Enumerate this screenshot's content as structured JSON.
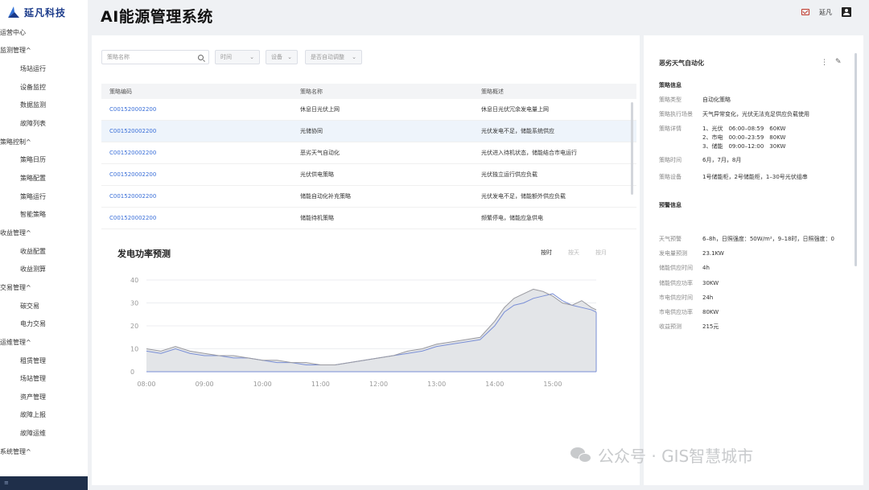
{
  "app": {
    "brand": "延凡科技",
    "title": "AI能源管理系统",
    "user": "延凡"
  },
  "sidebar": {
    "items": [
      {
        "label": "运营中心",
        "type": "group"
      },
      {
        "label": "监测管理",
        "type": "group",
        "chevron": "^"
      },
      {
        "label": "场站运行",
        "type": "sub"
      },
      {
        "label": "设备监控",
        "type": "sub"
      },
      {
        "label": "数据监测",
        "type": "sub"
      },
      {
        "label": "故障列表",
        "type": "sub"
      },
      {
        "label": "策略控制",
        "type": "group",
        "chevron": "^"
      },
      {
        "label": "策略日历",
        "type": "sub"
      },
      {
        "label": "策略配置",
        "type": "sub"
      },
      {
        "label": "策略运行",
        "type": "sub"
      },
      {
        "label": "智能策略",
        "type": "sub"
      },
      {
        "label": "收益管理",
        "type": "group",
        "chevron": "^"
      },
      {
        "label": "收益配置",
        "type": "sub"
      },
      {
        "label": "收益测算",
        "type": "sub"
      },
      {
        "label": "交易管理",
        "type": "group",
        "chevron": "^"
      },
      {
        "label": "碳交易",
        "type": "sub"
      },
      {
        "label": "电力交易",
        "type": "sub"
      },
      {
        "label": "运维管理",
        "type": "group",
        "chevron": "^"
      },
      {
        "label": "租赁管理",
        "type": "sub"
      },
      {
        "label": "场站管理",
        "type": "sub"
      },
      {
        "label": "资产管理",
        "type": "sub"
      },
      {
        "label": "故障上报",
        "type": "sub"
      },
      {
        "label": "故障运维",
        "type": "sub"
      },
      {
        "label": "系统管理",
        "type": "group",
        "chevron": "^"
      }
    ]
  },
  "filters": {
    "search_placeholder": "策略名称",
    "time": "时间",
    "device": "设备",
    "auto": "是否自动调整"
  },
  "table": {
    "headers": [
      "策略编码",
      "策略名称",
      "策略概述"
    ],
    "rows": [
      [
        "C001520002200",
        "休息日光伏上网",
        "休息日光伏冗余发电量上网"
      ],
      [
        "C001520002200",
        "光储协同",
        "光伏发电不足，储能系统供应"
      ],
      [
        "C001520002200",
        "恶劣天气自动化",
        "光伏进入待机状态，储能结合市电运行"
      ],
      [
        "C001520002200",
        "光伏供电策略",
        "光伏独立运行供应负载"
      ],
      [
        "C001520002200",
        "储能自动化补充策略",
        "光伏发电不足，储能额外供应负载"
      ],
      [
        "C001520002200",
        "储能待机策略",
        "频繁停电，储能应急供电"
      ]
    ]
  },
  "chart": {
    "title": "发电功率预测",
    "tabs": [
      "按时",
      "按天",
      "按月"
    ],
    "active_tab": "按时"
  },
  "chart_data": {
    "type": "area",
    "title": "发电功率预测",
    "x_ticks": [
      "08:00",
      "09:00",
      "10:00",
      "11:00",
      "12:00",
      "13:00",
      "14:00",
      "15:00"
    ],
    "y_ticks": [
      0,
      10,
      20,
      30,
      40
    ],
    "ylim": [
      0,
      40
    ],
    "xlim": [
      "08:00",
      "15:45"
    ],
    "series": [
      {
        "x": [
          "08:00",
          "08:15",
          "08:30",
          "08:45",
          "09:00",
          "09:15",
          "09:30",
          "09:45",
          "10:00",
          "10:15",
          "10:30",
          "10:45",
          "11:00",
          "11:15",
          "11:30",
          "11:45",
          "12:00",
          "12:15",
          "12:30",
          "12:45",
          "13:00",
          "13:15",
          "13:30",
          "13:45",
          "14:00",
          "14:10",
          "14:20",
          "14:30",
          "14:40",
          "14:50",
          "15:00",
          "15:10",
          "15:20",
          "15:30",
          "15:40",
          "15:45"
        ],
        "y": [
          9,
          8,
          10,
          8,
          7,
          7,
          6,
          6,
          5,
          4,
          4,
          3,
          3,
          3,
          4,
          5,
          6,
          7,
          8,
          9,
          11,
          12,
          13,
          14,
          20,
          26,
          29,
          30,
          32,
          33,
          34,
          31,
          29,
          28,
          27,
          26
        ]
      },
      {
        "x": [
          "08:00",
          "08:15",
          "08:30",
          "08:45",
          "09:00",
          "09:15",
          "09:30",
          "09:45",
          "10:00",
          "10:15",
          "10:30",
          "10:45",
          "11:00",
          "11:15",
          "11:30",
          "11:45",
          "12:00",
          "12:15",
          "12:30",
          "12:45",
          "13:00",
          "13:15",
          "13:30",
          "13:45",
          "14:00",
          "14:10",
          "14:20",
          "14:30",
          "14:40",
          "14:50",
          "15:00",
          "15:10",
          "15:20",
          "15:30",
          "15:40",
          "15:45"
        ],
        "y": [
          10,
          9,
          11,
          9,
          8,
          7,
          7,
          6,
          5,
          5,
          4,
          4,
          3,
          3,
          4,
          5,
          6,
          7,
          9,
          10,
          12,
          13,
          14,
          15,
          22,
          28,
          32,
          34,
          36,
          35,
          33,
          30,
          29,
          31,
          28,
          27
        ]
      }
    ],
    "colors": {
      "line1": "#7a8fd6",
      "line2": "#9a9aa0",
      "fill": "#e3e5e8"
    }
  },
  "detail": {
    "title": "恶劣天气自动化",
    "policy_section": "策略信息",
    "policy": [
      {
        "k": "策略类型",
        "v": [
          "自动化策略"
        ]
      },
      {
        "k": "策略执行场景",
        "v": [
          "天气异常变化，光伏无法充足供应负载使用"
        ]
      },
      {
        "k": "策略详情",
        "v": [
          "1、光伏　06:00–08:59　60KW",
          "2、市电　00:00–23:59　80KW",
          "3、储能　09:00–12:00　30KW"
        ]
      },
      {
        "k": "策略时间",
        "v": [
          "6月，7月，8月"
        ]
      },
      {
        "k": "策略设备",
        "v": [
          "1号储能柜，2号储能柜，1–30号光伏组串"
        ]
      }
    ],
    "warning_section": "预警信息",
    "warning": [
      {
        "k": "天气预警",
        "v": "6–8h，日照强度：50W/m²，9–18时，日照强度：0"
      },
      {
        "k": "发电量预测",
        "v": "23.1KW"
      },
      {
        "k": "储能供应时间",
        "v": "4h"
      },
      {
        "k": "储能供应功率",
        "v": "30KW"
      },
      {
        "k": "市电供应时间",
        "v": "24h"
      },
      {
        "k": "市电供应功率",
        "v": "80KW"
      },
      {
        "k": "收益预测",
        "v": "215元"
      }
    ]
  },
  "watermark": "公众号 · GIS智慧城市"
}
